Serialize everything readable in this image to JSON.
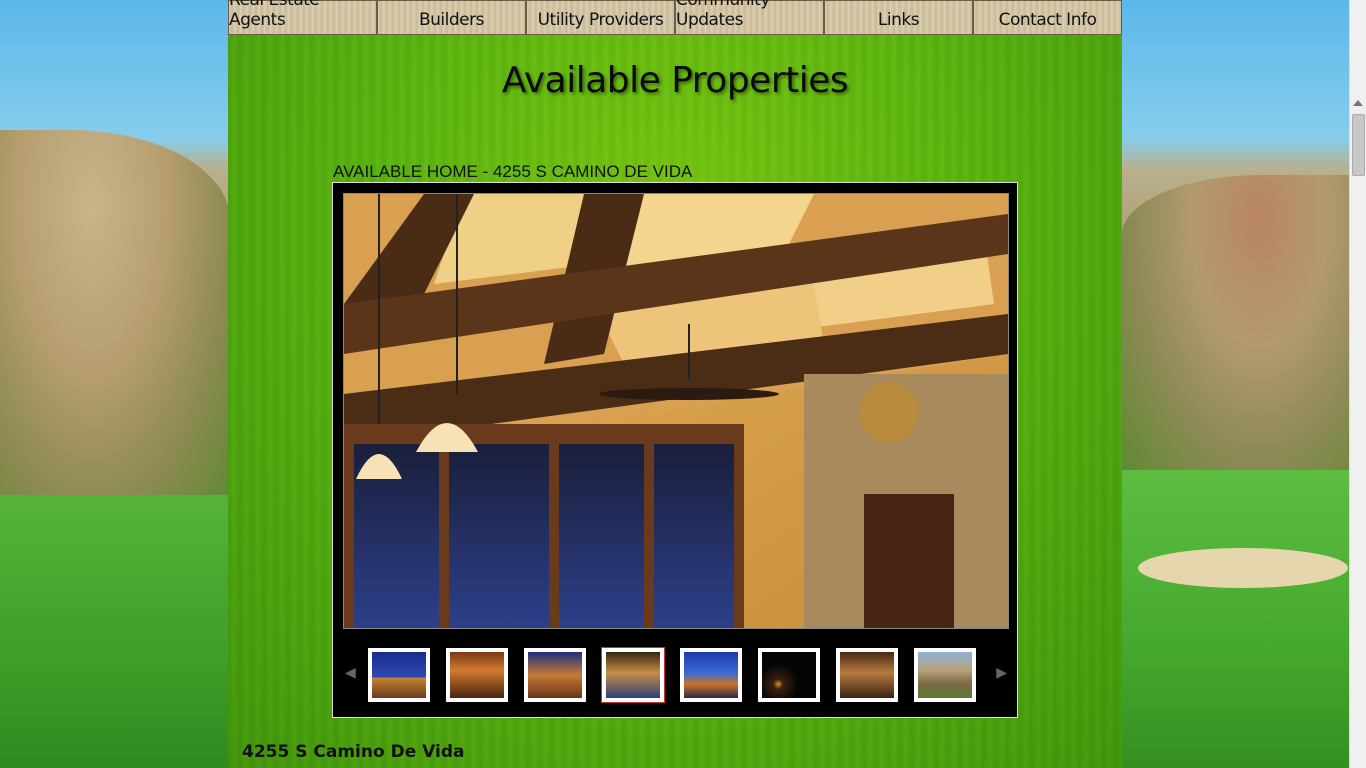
{
  "nav": {
    "items": [
      {
        "label": "Real Estate Agents"
      },
      {
        "label": "Builders"
      },
      {
        "label": "Utility Providers"
      },
      {
        "label": "Community Updates"
      },
      {
        "label": "Links"
      },
      {
        "label": "Contact Info"
      }
    ]
  },
  "page": {
    "title": "Available Properties"
  },
  "listing": {
    "heading": "AVAILABLE HOME - 4255 S CAMINO DE VIDA",
    "address": "4255 S Camino De Vida"
  },
  "gallery": {
    "prev_icon": "chevron-left-icon",
    "next_icon": "chevron-right-icon",
    "thumbnail_count": 8,
    "active_thumbnail": 4,
    "accent_active_border": "#cc3333"
  },
  "colors": {
    "panel_green": "#5cb611",
    "nav_wood": "#d8cbb0",
    "gallery_bg": "#000000"
  }
}
